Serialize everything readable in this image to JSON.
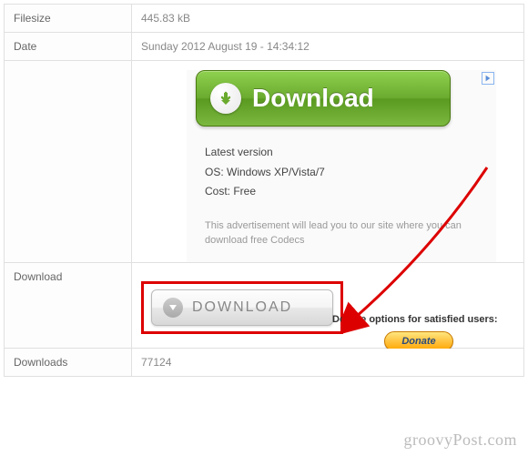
{
  "rows": {
    "filesize": {
      "label": "Filesize",
      "value": "445.83 kB"
    },
    "date": {
      "label": "Date",
      "value": "Sunday 2012 August 19 - 14:34:12"
    },
    "download": {
      "label": "Download"
    },
    "downloads": {
      "label": "Downloads",
      "value": "77124"
    }
  },
  "ad": {
    "button_text": "Download",
    "info_line1": "Latest version",
    "info_line2": "OS: Windows XP/Vista/7",
    "info_line3": "Cost: Free",
    "disclaimer": "This advertisement will lead you to our site where you can download free Codecs"
  },
  "grey_button": {
    "text": "DOWNLOAD"
  },
  "donate": {
    "text": "Donate options for satisfied users:",
    "button": "Donate"
  },
  "watermark": "groovyPost.com"
}
